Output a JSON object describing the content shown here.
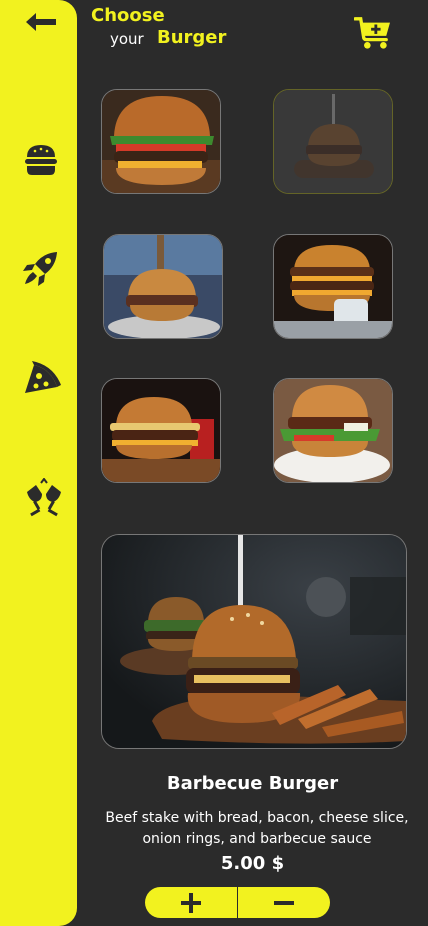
{
  "header": {
    "choose": "Choose",
    "your": "your",
    "burger": "Burger"
  },
  "icons": {
    "back": "arrow-left-icon",
    "cart": "cart-plus-icon",
    "categories": [
      "burger-icon",
      "rocket-icon",
      "pizza-icon",
      "cheers-icon"
    ]
  },
  "gallery": [
    {
      "name": "classic-burger",
      "selected": false
    },
    {
      "name": "burger-on-board",
      "selected": true
    },
    {
      "name": "skewered-burger",
      "selected": false
    },
    {
      "name": "stacked-burger",
      "selected": false
    },
    {
      "name": "grilled-burger",
      "selected": false
    },
    {
      "name": "lettuce-burger",
      "selected": false
    }
  ],
  "product": {
    "title": "Barbecue Burger",
    "description": "Beef stake with bread, bacon, cheese slice, onion rings, and barbecue sauce",
    "price": "5.00 $"
  },
  "stepper": {
    "plus": "plus-icon",
    "minus": "minus-icon"
  },
  "colors": {
    "accent": "#f2f21f",
    "background": "#2b2b2b",
    "icon_dark": "#2b2b2b"
  }
}
